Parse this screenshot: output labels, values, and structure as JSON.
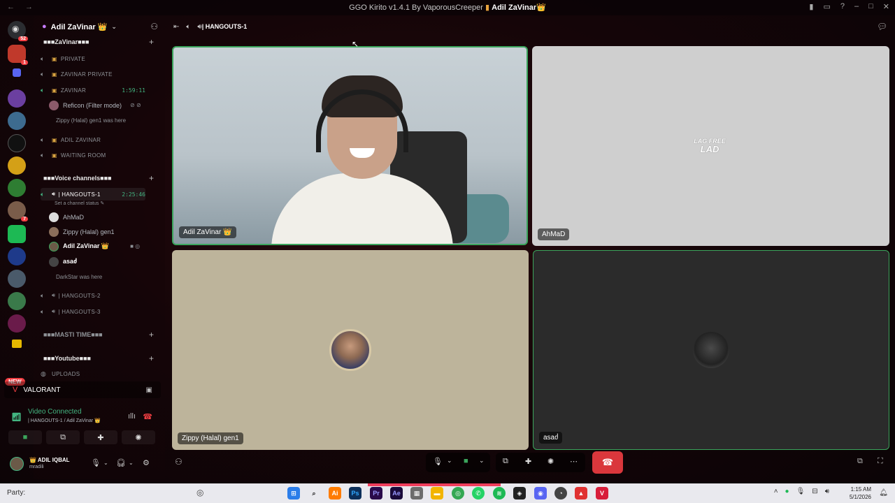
{
  "titlebar": {
    "title": "GGO Kirito v1.4.1 By VaporousCreeper",
    "user": "Adil ZaVinar",
    "crown": "👑"
  },
  "server_rail": {
    "home_badge": "52",
    "new_badge": "NEW",
    "badges": [
      "1",
      "7"
    ]
  },
  "sidebar": {
    "guild_name": "Adil ZaVinar 👑",
    "categories": {
      "zavinar": "■■■ZaVinar■■■",
      "voice": "■■■Voice channels■■■",
      "masti": "■■■MASTI TIME■■■",
      "youtube": "■■■Youtube■■■"
    },
    "channels": {
      "private": "PRIVATE",
      "zavinar_private": "ZAVINAR PRIVATE",
      "zavinar": "ZAVINAR",
      "zavinar_time": "1:59:11",
      "adil_zavinar": "ADIL ZAVINAR",
      "waiting_room": "WAITING ROOM",
      "hangouts1": "| HANGOUTS-1",
      "hangouts1_time": "2:25:46",
      "hangouts1_status": "Set a channel status",
      "hangouts2": "| HANGOUTS-2",
      "hangouts3": "| HANGOUTS-3",
      "uploads": "UPLOADS"
    },
    "members": {
      "reficon": "Reficon (Filter mode)",
      "zippy_here": "Zippy (Halal) gen1 was here",
      "ahmad": "AhMaD",
      "zippy": "Zippy (Halal) gen1",
      "adil": "Adil ZaVinar 👑",
      "asad": "asaძ",
      "darkstar_here": "DarkStar was here"
    }
  },
  "activity": {
    "name": "VALORANT"
  },
  "voice_panel": {
    "status": "Video Connected",
    "sub": "| HANGOUTS-1 / Adil ZaVinar 👑"
  },
  "user_panel": {
    "name": "👑 ADIL IQBAL",
    "tag": "mradili"
  },
  "call": {
    "channel": "| HANGOUTS-1",
    "tiles": {
      "t1": "Adil ZaVinar 👑",
      "t2": "AhMaD",
      "t2_logo_line1": "LAG FREE",
      "t2_logo_line2": "LAD",
      "t3": "Zippy (Halal) gen1",
      "t4": "asaძ"
    }
  },
  "taskbar": {
    "party": "Party:",
    "clock_time": "1:15 AM",
    "clock_date": "5/1/2026"
  },
  "colors": {
    "speaking": "#3ba55c",
    "end_call": "#da373c",
    "badge": "#f23f43"
  }
}
